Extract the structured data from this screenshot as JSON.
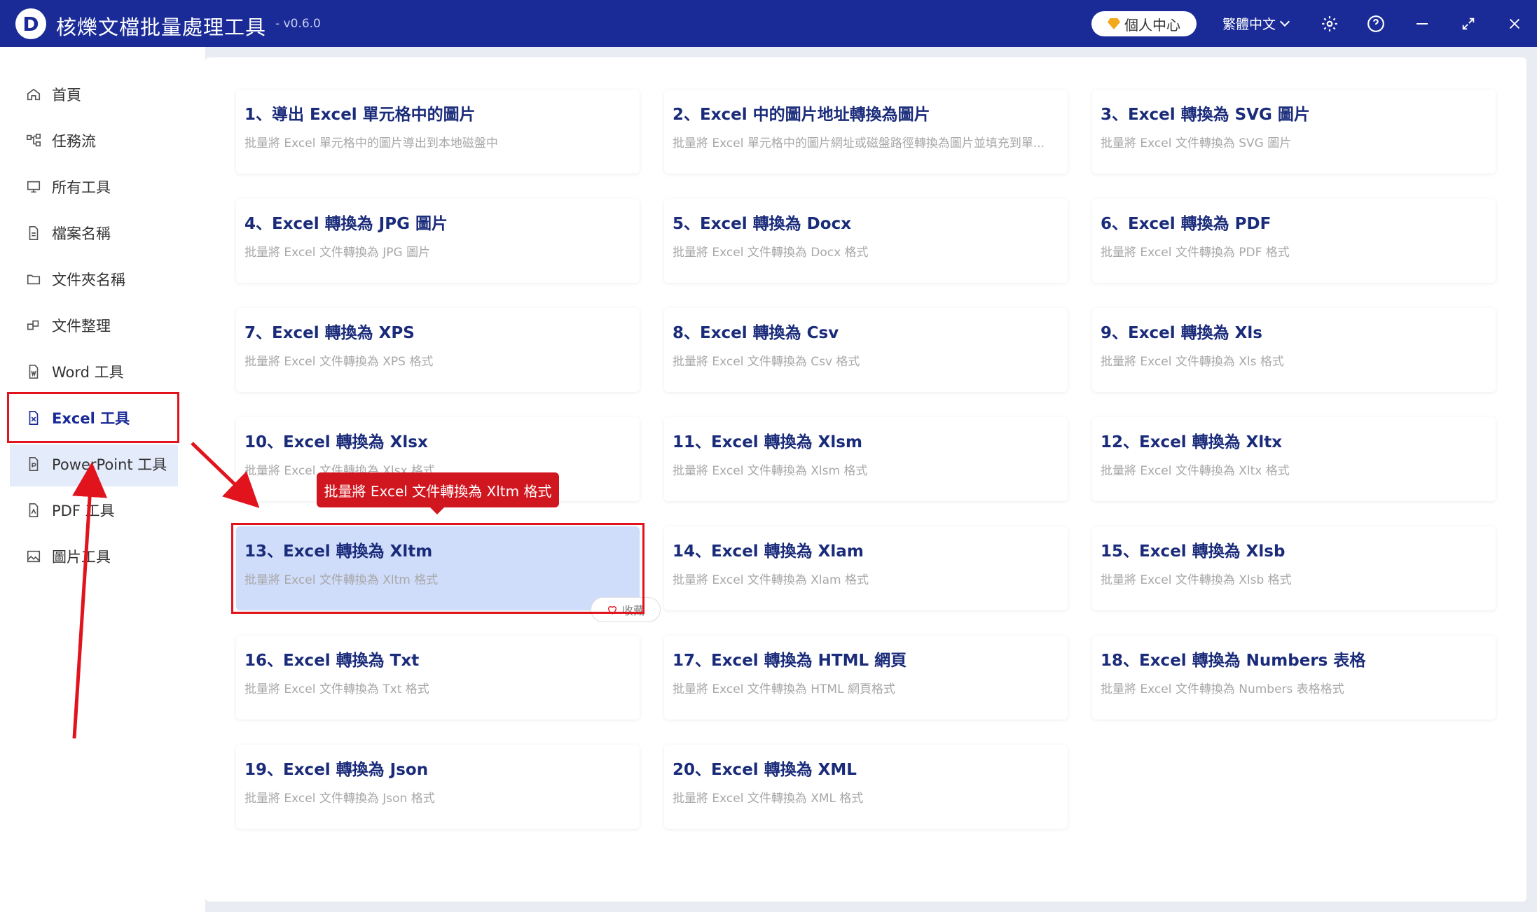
{
  "app": {
    "logo_letter": "D",
    "title": "核爍文檔批量處理工具",
    "version": "- v0.6.0",
    "vip_label": "個人中心",
    "language": "繁體中文",
    "accent_color": "#1a2b98"
  },
  "sidebar": {
    "items": [
      {
        "label": "首頁",
        "icon": "home-icon"
      },
      {
        "label": "任務流",
        "icon": "workflow-icon"
      },
      {
        "label": "所有工具",
        "icon": "monitor-icon"
      },
      {
        "label": "檔案名稱",
        "icon": "file-icon"
      },
      {
        "label": "文件夾名稱",
        "icon": "folder-icon"
      },
      {
        "label": "文件整理",
        "icon": "organize-icon"
      },
      {
        "label": "Word 工具",
        "icon": "word-icon"
      },
      {
        "label": "Excel 工具",
        "icon": "excel-icon",
        "active": true
      },
      {
        "label": "PowerPoint 工具",
        "icon": "ppt-icon"
      },
      {
        "label": "PDF 工具",
        "icon": "pdf-icon"
      },
      {
        "label": "圖片工具",
        "icon": "image-icon"
      }
    ]
  },
  "tools": [
    {
      "title": "1、導出 Excel 單元格中的圖片",
      "desc": "批量將 Excel 單元格中的圖片導出到本地磁盤中"
    },
    {
      "title": "2、Excel 中的圖片地址轉換為圖片",
      "desc": "批量將 Excel 單元格中的圖片網址或磁盤路徑轉換為圖片並填充到單..."
    },
    {
      "title": "3、Excel 轉換為 SVG 圖片",
      "desc": "批量將 Excel 文件轉換為 SVG 圖片"
    },
    {
      "title": "4、Excel 轉換為 JPG 圖片",
      "desc": "批量將 Excel 文件轉換為 JPG 圖片"
    },
    {
      "title": "5、Excel 轉換為 Docx",
      "desc": "批量將 Excel 文件轉換為 Docx 格式"
    },
    {
      "title": "6、Excel 轉換為 PDF",
      "desc": "批量將 Excel 文件轉換為 PDF 格式"
    },
    {
      "title": "7、Excel 轉換為 XPS",
      "desc": "批量將 Excel 文件轉換為 XPS 格式"
    },
    {
      "title": "8、Excel 轉換為 Csv",
      "desc": "批量將 Excel 文件轉換為 Csv 格式"
    },
    {
      "title": "9、Excel 轉換為 Xls",
      "desc": "批量將 Excel 文件轉換為 Xls 格式"
    },
    {
      "title": "10、Excel 轉換為 Xlsx",
      "desc": "批量將 Excel 文件轉換為 Xlsx 格式"
    },
    {
      "title": "11、Excel 轉換為 Xlsm",
      "desc": "批量將 Excel 文件轉換為 Xlsm 格式"
    },
    {
      "title": "12、Excel 轉換為 Xltx",
      "desc": "批量將 Excel 文件轉換為 Xltx 格式"
    },
    {
      "title": "13、Excel 轉換為 Xltm",
      "desc": "批量將 Excel 文件轉換為 Xltm 格式",
      "highlighted": true
    },
    {
      "title": "14、Excel 轉換為 Xlam",
      "desc": "批量將 Excel 文件轉換為 Xlam 格式"
    },
    {
      "title": "15、Excel 轉換為 Xlsb",
      "desc": "批量將 Excel 文件轉換為 Xlsb 格式"
    },
    {
      "title": "16、Excel 轉換為 Txt",
      "desc": "批量將 Excel 文件轉換為 Txt 格式"
    },
    {
      "title": "17、Excel 轉換為 HTML 網頁",
      "desc": "批量將 Excel 文件轉換為 HTML 網頁格式"
    },
    {
      "title": "18、Excel 轉換為 Numbers 表格",
      "desc": "批量將 Excel 文件轉換為 Numbers 表格格式"
    },
    {
      "title": "19、Excel 轉換為 Json",
      "desc": "批量將 Excel 文件轉換為 Json 格式"
    },
    {
      "title": "20、Excel 轉換為 XML",
      "desc": "批量將 Excel 文件轉換為 XML 格式"
    }
  ],
  "favorite_label": "收藏",
  "tooltip": "批量將 Excel 文件轉換為 Xltm 格式",
  "annotation_color": "#e1141e"
}
